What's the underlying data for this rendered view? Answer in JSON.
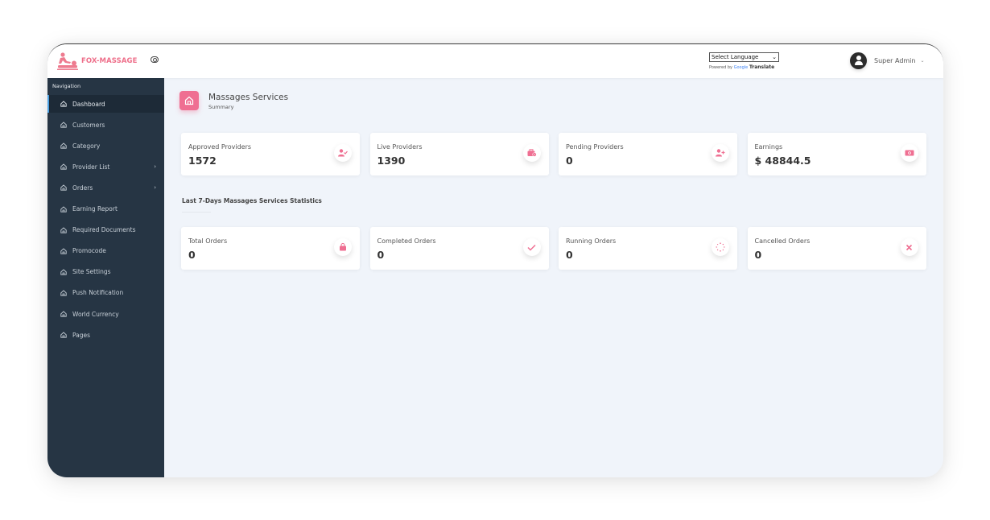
{
  "app": {
    "brand": "FOX-MASSAGE",
    "brand_color": "#ee6f8a",
    "accent_color": "#ef6f92",
    "sidebar_color": "#263544"
  },
  "topbar": {
    "language_select": "Select Language",
    "powered_by": "Powered by",
    "google": "Google",
    "translate": "Translate",
    "user_name": "Super Admin"
  },
  "sidebar": {
    "title": "Navigation",
    "items": [
      {
        "label": "Dashboard",
        "active": true
      },
      {
        "label": "Customers"
      },
      {
        "label": "Category"
      },
      {
        "label": "Provider List",
        "has_children": true
      },
      {
        "label": "Orders",
        "has_children": true
      },
      {
        "label": "Earning Report"
      },
      {
        "label": "Required Documents"
      },
      {
        "label": "Promocode"
      },
      {
        "label": "Site Settings"
      },
      {
        "label": "Push Notification"
      },
      {
        "label": "World Currency"
      },
      {
        "label": "Pages"
      }
    ]
  },
  "page": {
    "title": "Massages Services",
    "subtitle": "Summary"
  },
  "summary_cards": [
    {
      "label": "Approved Providers",
      "value": "1572",
      "icon": "user-check-icon"
    },
    {
      "label": "Live Providers",
      "value": "1390",
      "icon": "briefcase-clock-icon"
    },
    {
      "label": "Pending Providers",
      "value": "0",
      "icon": "user-plus-icon"
    },
    {
      "label": "Earnings",
      "value": "$ 48844.5",
      "icon": "money-bill-icon"
    }
  ],
  "stats_section": {
    "title": "Last 7-Days Massages Services Statistics"
  },
  "stats_cards": [
    {
      "label": "Total Orders",
      "value": "0",
      "icon": "shopping-bag-icon"
    },
    {
      "label": "Completed Orders",
      "value": "0",
      "icon": "check-icon"
    },
    {
      "label": "Running Orders",
      "value": "0",
      "icon": "spinner-icon"
    },
    {
      "label": "Cancelled Orders",
      "value": "0",
      "icon": "close-icon"
    }
  ]
}
